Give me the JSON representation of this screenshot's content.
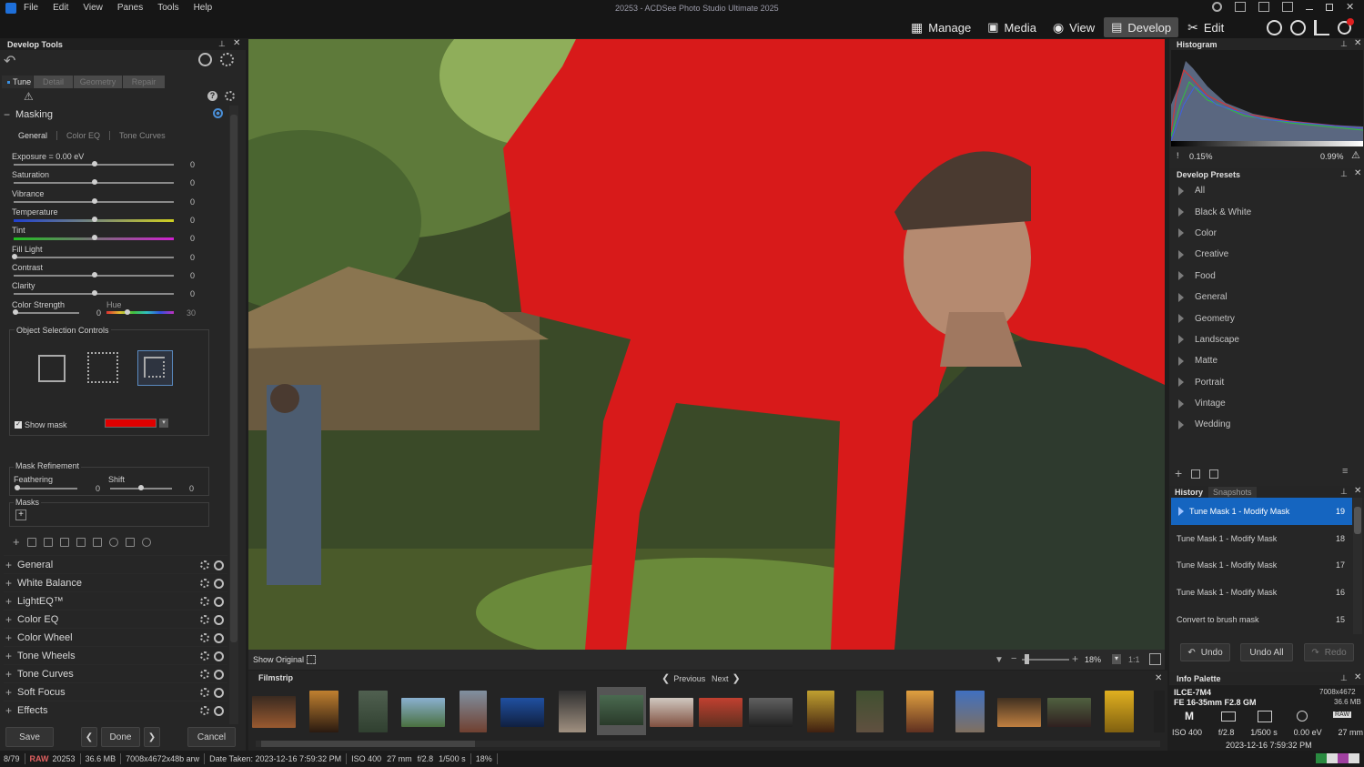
{
  "app": {
    "title": "20253 - ACDSee Photo Studio Ultimate 2025"
  },
  "menu": [
    "File",
    "Edit",
    "View",
    "Panes",
    "Tools",
    "Help"
  ],
  "modes": [
    {
      "label": "Manage",
      "icon": "grid-icon"
    },
    {
      "label": "Media",
      "icon": "media-icon"
    },
    {
      "label": "View",
      "icon": "eye-icon"
    },
    {
      "label": "Develop",
      "icon": "develop-icon",
      "active": true
    },
    {
      "label": "Edit",
      "icon": "edit-icon"
    }
  ],
  "left": {
    "header": "Develop Tools",
    "tabs": [
      "Tune",
      "Detail",
      "Geometry",
      "Repair"
    ],
    "masking": {
      "title": "Masking",
      "subtabs": [
        "General",
        "Color EQ",
        "Tone Curves"
      ],
      "sliders": [
        {
          "label": "Exposure = 0.00 eV",
          "value": "0",
          "pos": 0.5,
          "colors": ""
        },
        {
          "label": "Saturation",
          "value": "0",
          "pos": 0.5,
          "colors": ""
        },
        {
          "label": "Vibrance",
          "value": "0",
          "pos": 0.5,
          "colors": ""
        },
        {
          "label": "Temperature",
          "value": "0",
          "pos": 0.5,
          "colors": "temp"
        },
        {
          "label": "Tint",
          "value": "0",
          "pos": 0.5,
          "colors": "tint"
        },
        {
          "label": "Fill Light",
          "value": "0",
          "pos": 0.0,
          "colors": ""
        },
        {
          "label": "Contrast",
          "value": "0",
          "pos": 0.5,
          "colors": ""
        },
        {
          "label": "Clarity",
          "value": "0",
          "pos": 0.5,
          "colors": ""
        }
      ],
      "color_strength": {
        "label": "Color Strength",
        "value": "0",
        "hue_label": "Hue",
        "hue_value": "30"
      },
      "object_selection": "Object Selection Controls",
      "show_mask": "Show mask",
      "mask_color": "#e00000",
      "refinement": {
        "title": "Mask Refinement",
        "feathering": "Feathering",
        "feather_value": "0",
        "shift": "Shift",
        "shift_value": "0"
      },
      "masks_label": "Masks"
    },
    "sections": [
      "General",
      "White Balance",
      "LightEQ™",
      "Color EQ",
      "Color Wheel",
      "Tone Wheels",
      "Tone Curves",
      "Soft Focus",
      "Effects"
    ],
    "buttons": {
      "save": "Save",
      "done": "Done",
      "cancel": "Cancel"
    }
  },
  "viewer": {
    "show_original": "Show Original",
    "zoom": "18%",
    "ratio": "1:1"
  },
  "filmstrip": {
    "title": "Filmstrip",
    "previous": "Previous",
    "next": "Next"
  },
  "right": {
    "histogram": {
      "title": "Histogram",
      "low": "0.15%",
      "high": "0.99%"
    },
    "presets": {
      "title": "Develop Presets",
      "items": [
        "All",
        "Black & White",
        "Color",
        "Creative",
        "Food",
        "General",
        "Geometry",
        "Landscape",
        "Matte",
        "Portrait",
        "Vintage",
        "Wedding"
      ]
    },
    "history": {
      "tabs": [
        "History",
        "Snapshots"
      ],
      "items": [
        {
          "label": "Tune Mask 1 - Modify Mask",
          "n": "19"
        },
        {
          "label": "Tune Mask 1 - Modify Mask",
          "n": "18"
        },
        {
          "label": "Tune Mask 1 - Modify Mask",
          "n": "17"
        },
        {
          "label": "Tune Mask 1 - Modify Mask",
          "n": "16"
        },
        {
          "label": "Convert to brush mask",
          "n": "15"
        }
      ],
      "undo": "Undo",
      "undo_all": "Undo All",
      "redo": "Redo"
    },
    "info": {
      "title": "Info Palette",
      "camera": "ILCE-7M4",
      "lens": "FE 16-35mm F2.8 GM",
      "dims": "7008x4672",
      "size": "36.6 MB",
      "mode": "M",
      "iso": "ISO 400",
      "aperture": "f/2.8",
      "shutter": "1/500 s",
      "ev": "0.00 eV",
      "focal": "27 mm",
      "raw": "RAW",
      "date": "2023-12-16 7:59:32 PM"
    }
  },
  "status": {
    "index": "8/79",
    "format": "RAW",
    "name": "20253",
    "size": "36.6 MB",
    "dims": "7008x4672x48b arw",
    "date": "Date Taken: 2023-12-16 7:59:32 PM",
    "iso": "ISO 400",
    "focal": "27 mm",
    "aperture": "f/2.8",
    "shutter": "1/500 s",
    "zoom": "18%"
  },
  "colors": {
    "accent": "#1565c0",
    "mask": "#e00000"
  }
}
